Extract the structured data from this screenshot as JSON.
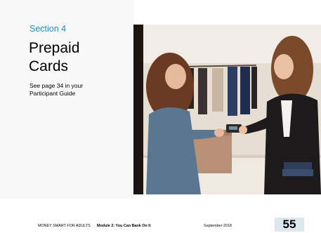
{
  "slide": {
    "section_label": "Section 4",
    "title_line1": "Prepaid",
    "title_line2": "Cards",
    "subtitle_line1": "See page 34 in your",
    "subtitle_line2": "Participant Guide",
    "photo_icon": "photo-image"
  },
  "footer": {
    "program": "MONEY SMART FOR ADULTS",
    "module": "Module 2: You Can Bank On It",
    "date": "September 2018",
    "page_number": "55"
  },
  "colors": {
    "accent": "#1a8fc1",
    "page_box": "#dce7f0"
  }
}
